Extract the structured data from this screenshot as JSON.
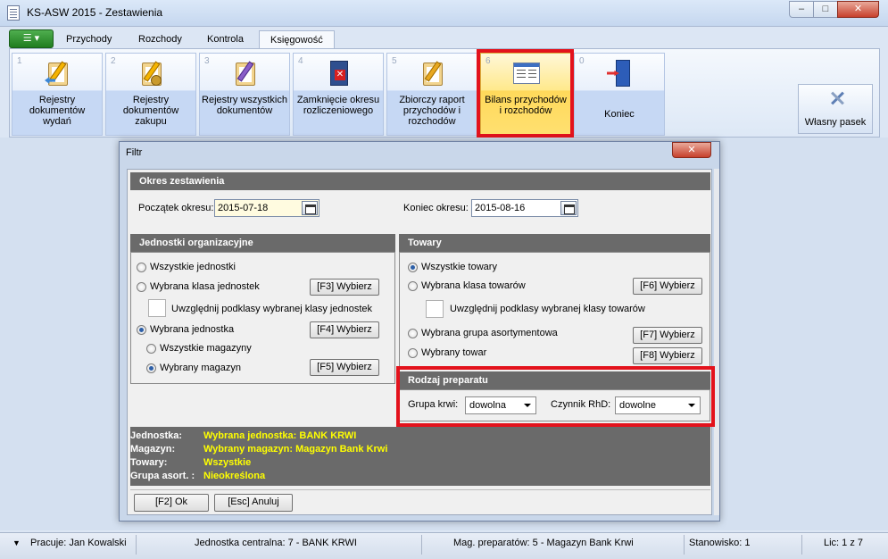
{
  "window": {
    "title": "KS-ASW 2015 - Zestawienia"
  },
  "ribbon_tabs": [
    {
      "label": "Przychody"
    },
    {
      "label": "Rozchody"
    },
    {
      "label": "Kontrola"
    },
    {
      "label": "Księgowość"
    }
  ],
  "active_tab": "Księgowość",
  "ribbon_buttons": [
    {
      "num": "1",
      "label": "Rejestry dokumentów wydań"
    },
    {
      "num": "2",
      "label": "Rejestry dokumentów zakupu"
    },
    {
      "num": "3",
      "label": "Rejestry wszystkich dokumentów"
    },
    {
      "num": "4",
      "label": "Zamknięcie okresu rozliczeniowego"
    },
    {
      "num": "5",
      "label": "Zbiorczy raport przychodów i rozchodów"
    },
    {
      "num": "6",
      "label": "Bilans przychodów i rozchodów"
    },
    {
      "num": "0",
      "label": "Koniec"
    }
  ],
  "wlasny_pasek": "Własny pasek",
  "dialog": {
    "title": "Filtr",
    "okres": {
      "header": "Okres zestawienia",
      "poczatek_label": "Początek okresu:",
      "poczatek_value": "2015-07-18",
      "koniec_label": "Koniec okresu:",
      "koniec_value": "2015-08-16"
    },
    "jednostki": {
      "header": "Jednostki organizacyjne",
      "wszystkie": "Wszystkie jednostki",
      "klasa": "Wybrana klasa jednostek",
      "podklasy": "Uwzględnij podklasy wybranej klasy jednostek",
      "wybrana": "Wybrana jednostka",
      "wszystkie_mag": "Wszystkie magazyny",
      "wybrany_mag": "Wybrany magazyn",
      "btn_f3": "[F3] Wybierz",
      "btn_f4": "[F4] Wybierz",
      "btn_f5": "[F5] Wybierz"
    },
    "towary": {
      "header": "Towary",
      "wszystkie": "Wszystkie towary",
      "klasa": "Wybrana klasa towarów",
      "podklasy": "Uwzględnij podklasy wybranej klasy towarów",
      "grupa": "Wybrana grupa asortymentowa",
      "towar": "Wybrany towar",
      "btn_f6": "[F6] Wybierz",
      "btn_f7": "[F7] Wybierz",
      "btn_f8": "[F8] Wybierz"
    },
    "rodzaj": {
      "header": "Rodzaj preparatu",
      "grupa_label": "Grupa krwi:",
      "grupa_value": "dowolna",
      "czynnik_label": "Czynnik RhD:",
      "czynnik_value": "dowolne"
    },
    "summary": [
      {
        "key": "Jednostka:",
        "value": "Wybrana jednostka: BANK KRWI"
      },
      {
        "key": "Magazyn:",
        "value": "Wybrany magazyn: Magazyn Bank Krwi"
      },
      {
        "key": "Towary:",
        "value": "Wszystkie"
      },
      {
        "key": "Grupa asort. :",
        "value": "Nieokreślona"
      }
    ],
    "ok": "[F2] Ok",
    "cancel": "[Esc] Anuluj"
  },
  "status": {
    "user": "Pracuje: Jan Kowalski",
    "unit": "Jednostka centralna: 7 - BANK KRWI",
    "mag": "Mag. preparatów:  5 - Magazyn Bank Krwi",
    "station": "Stanowisko: 1",
    "lic": "Lic: 1 z 7"
  },
  "colors": {
    "highlight": "#e3121c",
    "summary_value": "#ffff00",
    "section_header": "#6a6a6a"
  }
}
